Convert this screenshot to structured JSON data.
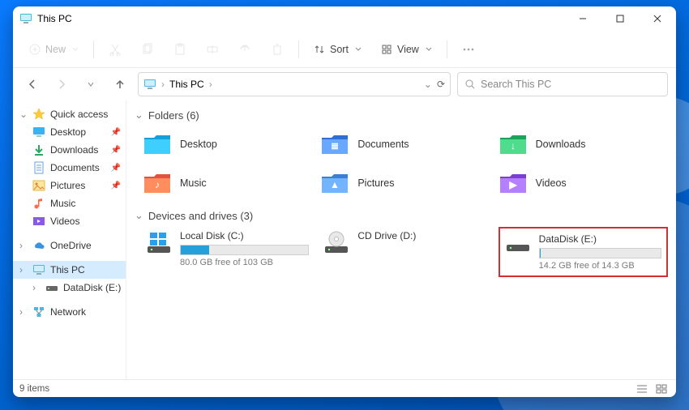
{
  "window": {
    "title": "This PC"
  },
  "toolbar": {
    "new_label": "New",
    "sort_label": "Sort",
    "view_label": "View"
  },
  "address": {
    "root": "This PC",
    "search_placeholder": "Search This PC"
  },
  "sidebar": {
    "quick_access": "Quick access",
    "items": [
      {
        "label": "Desktop"
      },
      {
        "label": "Downloads"
      },
      {
        "label": "Documents"
      },
      {
        "label": "Pictures"
      },
      {
        "label": "Music"
      },
      {
        "label": "Videos"
      }
    ],
    "onedrive": "OneDrive",
    "this_pc": "This PC",
    "datadisk": "DataDisk (E:)",
    "network": "Network"
  },
  "content": {
    "folders_header": "Folders (6)",
    "folders": [
      {
        "label": "Desktop",
        "color1": "#3fcfff",
        "color2": "#14a0d8"
      },
      {
        "label": "Documents",
        "color1": "#69a8ff",
        "color2": "#2e6fd6"
      },
      {
        "label": "Downloads",
        "color1": "#4fdc8d",
        "color2": "#1aa45a"
      },
      {
        "label": "Music",
        "color1": "#ff8d5d",
        "color2": "#e0543f"
      },
      {
        "label": "Pictures",
        "color1": "#73b4ff",
        "color2": "#3a7ed8"
      },
      {
        "label": "Videos",
        "color1": "#b580ff",
        "color2": "#7d3ed6"
      }
    ],
    "drives_header": "Devices and drives (3)",
    "drives": [
      {
        "label": "Local Disk (C:)",
        "free_text": "80.0 GB free of 103 GB",
        "used_pct": 22,
        "type": "os"
      },
      {
        "label": "CD Drive (D:)",
        "free_text": "",
        "used_pct": null,
        "type": "cd"
      },
      {
        "label": "DataDisk (E:)",
        "free_text": "14.2 GB free of 14.3 GB",
        "used_pct": 1,
        "type": "hdd",
        "highlight": true
      }
    ]
  },
  "status": {
    "items_text": "9 items"
  }
}
